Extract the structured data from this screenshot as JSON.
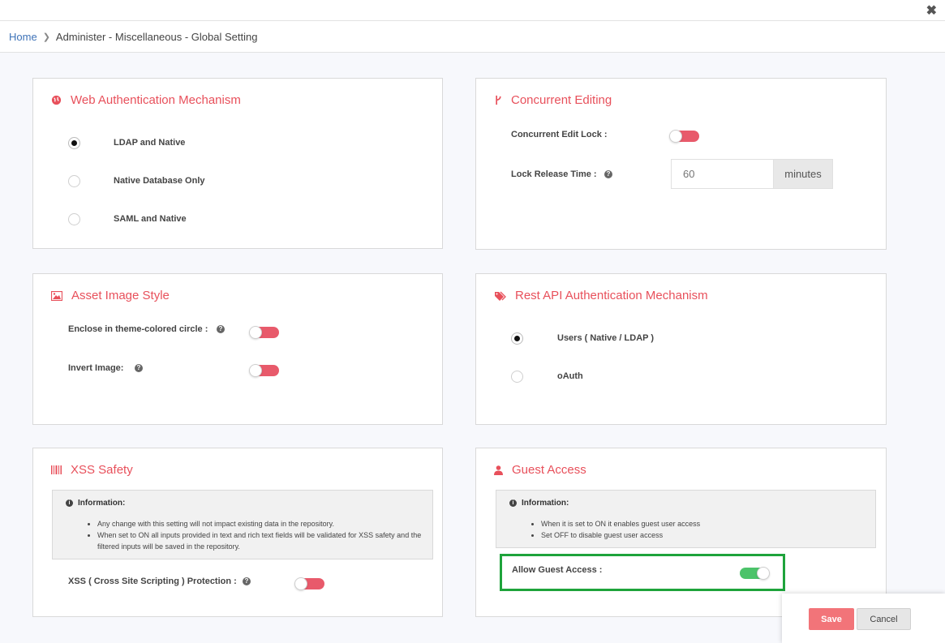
{
  "breadcrumb": {
    "home": "Home",
    "current": "Administer - Miscellaneous - Global Setting"
  },
  "colors": {
    "accent": "#e8505b",
    "toggle_off": "#e85a6b",
    "toggle_on": "#4cc36a",
    "highlight": "#1ea33b",
    "link": "#3f73b8"
  },
  "web_auth": {
    "title": "Web Authentication Mechanism",
    "icon": "globe-icon",
    "options": [
      {
        "label": "LDAP and Native",
        "selected": true
      },
      {
        "label": "Native Database Only",
        "selected": false
      },
      {
        "label": "SAML and Native",
        "selected": false
      }
    ]
  },
  "concurrent": {
    "title": "Concurrent Editing",
    "icon": "branch-icon",
    "lock_label": "Concurrent Edit Lock :",
    "lock_state": "off",
    "release_label": "Lock Release Time :",
    "release_placeholder": "60",
    "release_unit": "minutes"
  },
  "asset_image": {
    "title": "Asset Image Style",
    "icon": "image-icon",
    "enclose_label": "Enclose in theme-colored circle :",
    "enclose_state": "off",
    "invert_label": "Invert Image:",
    "invert_state": "off"
  },
  "rest_api": {
    "title": "Rest API Authentication Mechanism",
    "icon": "tags-icon",
    "options": [
      {
        "label": "Users ( Native / LDAP )",
        "selected": true
      },
      {
        "label": "oAuth",
        "selected": false
      }
    ]
  },
  "xss": {
    "title": "XSS Safety",
    "icon": "barcode-icon",
    "info_title": "Information:",
    "info_items": [
      "Any change with this setting will not impact existing data in the repository.",
      "When set to ON all inputs provided in text and rich text fields will be validated for XSS safety and the filtered inputs will be saved in the repository."
    ],
    "protection_label": "XSS ( Cross Site Scripting ) Protection :",
    "protection_state": "off"
  },
  "guest": {
    "title": "Guest Access",
    "icon": "user-icon",
    "info_title": "Information:",
    "info_items": [
      "When it is set to ON it enables guest user access",
      "Set OFF to disable guest user access"
    ],
    "allow_label": "Allow Guest Access :",
    "allow_state": "on"
  },
  "actions": {
    "save": "Save",
    "cancel": "Cancel"
  }
}
